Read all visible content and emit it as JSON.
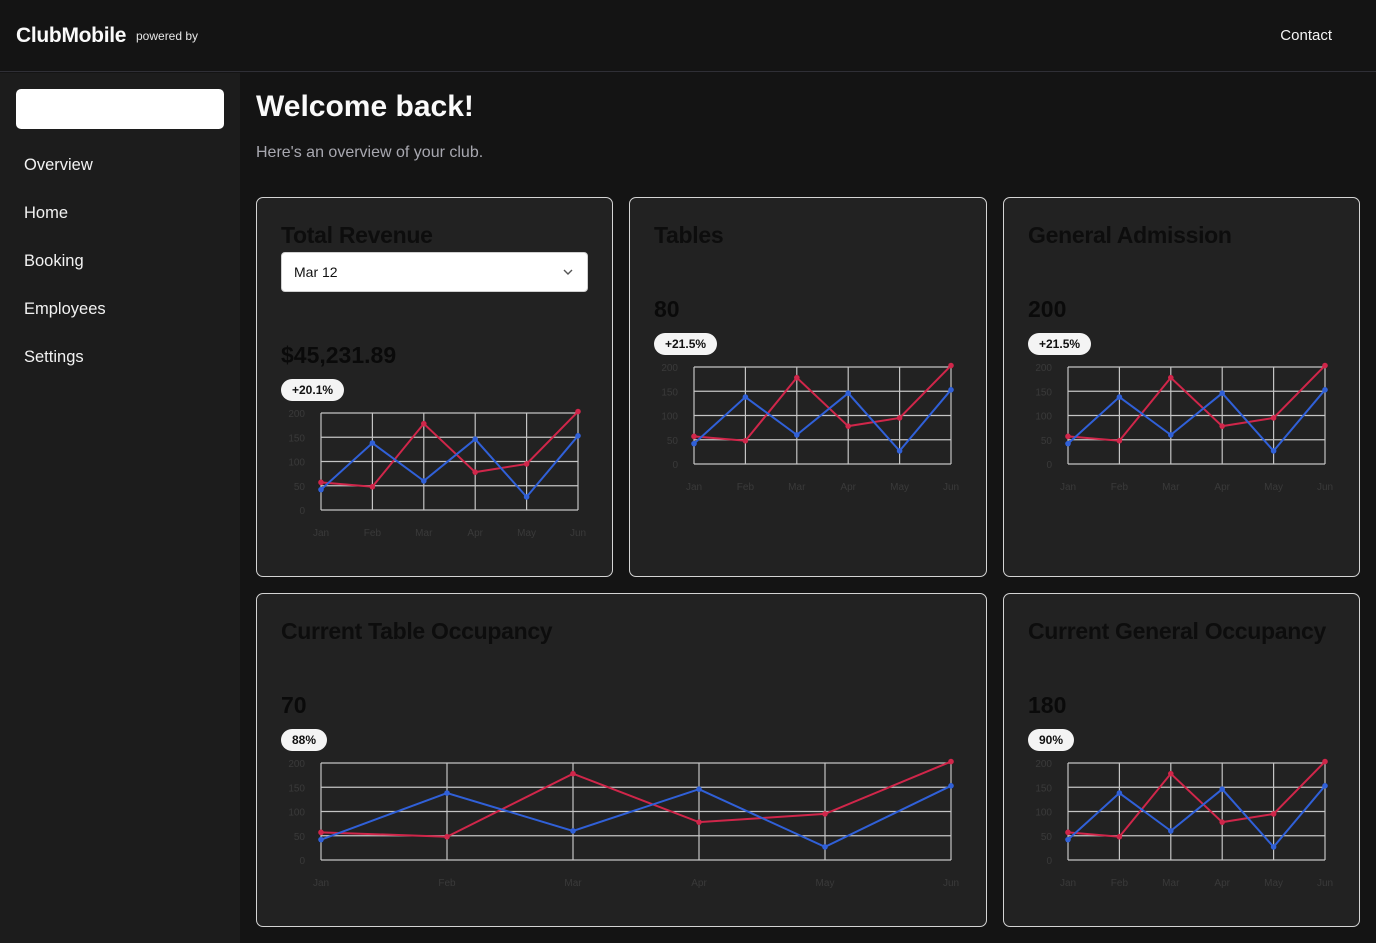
{
  "header": {
    "brand": "ClubMobile",
    "powered_by": "powered by",
    "contact_label": "Contact"
  },
  "sidebar": {
    "search_placeholder": "",
    "items": [
      {
        "label": "Overview"
      },
      {
        "label": "Home"
      },
      {
        "label": "Booking"
      },
      {
        "label": "Employees"
      },
      {
        "label": "Settings"
      }
    ]
  },
  "main": {
    "title": "Welcome back!",
    "subtitle": "Here's an overview of your club."
  },
  "cards": {
    "revenue": {
      "title": "Total Revenue",
      "select_value": "Mar 12",
      "value": "$45,231.89",
      "badge": "+20.1%"
    },
    "tables": {
      "title": "Tables",
      "value": "80",
      "badge": "+21.5%"
    },
    "general": {
      "title": "General Admission",
      "value": "200",
      "badge": "+21.5%"
    },
    "table_occupancy": {
      "title": "Current Table Occupancy",
      "value": "70",
      "badge": "88%"
    },
    "general_occupancy": {
      "title": "Current General Occupancy",
      "value": "180",
      "badge": "90%"
    }
  },
  "colors": {
    "series_red": "#d0264a",
    "series_blue": "#3060d8",
    "grid": "#c4c4c4"
  },
  "chart_data": [
    {
      "type": "line",
      "categories": [
        "Jan",
        "Feb",
        "Mar",
        "Apr",
        "May",
        "Jun"
      ],
      "yticks": [
        0,
        50,
        100,
        150,
        200
      ],
      "ylim": [
        0,
        200
      ],
      "series": [
        {
          "color": "#d0264a",
          "values": [
            57,
            48,
            178,
            78,
            95,
            203
          ]
        },
        {
          "color": "#3060d8",
          "values": [
            42,
            138,
            60,
            146,
            27,
            153
          ]
        }
      ]
    },
    {
      "type": "line",
      "categories": [
        "Jan",
        "Feb",
        "Mar",
        "Apr",
        "May",
        "Jun"
      ],
      "yticks": [
        0,
        50,
        100,
        150,
        200
      ],
      "ylim": [
        0,
        200
      ],
      "series": [
        {
          "color": "#d0264a",
          "values": [
            57,
            48,
            178,
            78,
            95,
            203
          ]
        },
        {
          "color": "#3060d8",
          "values": [
            42,
            138,
            60,
            146,
            27,
            153
          ]
        }
      ]
    },
    {
      "type": "line",
      "categories": [
        "Jan",
        "Feb",
        "Mar",
        "Apr",
        "May",
        "Jun"
      ],
      "yticks": [
        0,
        50,
        100,
        150,
        200
      ],
      "ylim": [
        0,
        200
      ],
      "series": [
        {
          "color": "#d0264a",
          "values": [
            57,
            48,
            178,
            78,
            95,
            203
          ]
        },
        {
          "color": "#3060d8",
          "values": [
            42,
            138,
            60,
            146,
            27,
            153
          ]
        }
      ]
    },
    {
      "type": "line",
      "categories": [
        "Jan",
        "Feb",
        "Mar",
        "Apr",
        "May",
        "Jun"
      ],
      "yticks": [
        0,
        50,
        100,
        150,
        200
      ],
      "ylim": [
        0,
        200
      ],
      "series": [
        {
          "color": "#d0264a",
          "values": [
            57,
            48,
            178,
            78,
            95,
            203
          ]
        },
        {
          "color": "#3060d8",
          "values": [
            42,
            138,
            60,
            146,
            27,
            153
          ]
        }
      ]
    },
    {
      "type": "line",
      "categories": [
        "Jan",
        "Feb",
        "Mar",
        "Apr",
        "May",
        "Jun"
      ],
      "yticks": [
        0,
        50,
        100,
        150,
        200
      ],
      "ylim": [
        0,
        200
      ],
      "series": [
        {
          "color": "#d0264a",
          "values": [
            57,
            48,
            178,
            78,
            95,
            203
          ]
        },
        {
          "color": "#3060d8",
          "values": [
            42,
            138,
            60,
            146,
            27,
            153
          ]
        }
      ]
    }
  ]
}
